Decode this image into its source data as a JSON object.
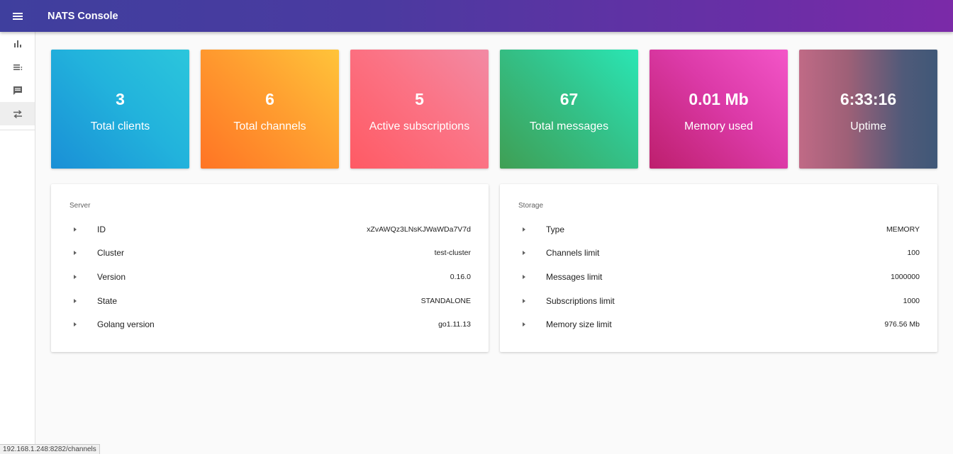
{
  "app": {
    "title": "NATS Console"
  },
  "sidebar": {
    "items": [
      {
        "icon": "bar-chart-icon",
        "active": false
      },
      {
        "icon": "list-icon",
        "active": false
      },
      {
        "icon": "message-icon",
        "active": false
      },
      {
        "icon": "swap-arrows-icon",
        "active": true
      }
    ]
  },
  "stats": [
    {
      "value": "3",
      "label": "Total clients"
    },
    {
      "value": "6",
      "label": "Total channels"
    },
    {
      "value": "5",
      "label": "Active subscriptions"
    },
    {
      "value": "67",
      "label": "Total messages"
    },
    {
      "value": "0.01 Mb",
      "label": "Memory used"
    },
    {
      "value": "6:33:16",
      "label": "Uptime"
    }
  ],
  "server": {
    "title": "Server",
    "rows": [
      {
        "key": "ID",
        "value": "xZvAWQz3LNsKJWaWDa7V7d"
      },
      {
        "key": "Cluster",
        "value": "test-cluster"
      },
      {
        "key": "Version",
        "value": "0.16.0"
      },
      {
        "key": "State",
        "value": "STANDALONE"
      },
      {
        "key": "Golang version",
        "value": "go1.11.13"
      }
    ]
  },
  "storage": {
    "title": "Storage",
    "rows": [
      {
        "key": "Type",
        "value": "MEMORY"
      },
      {
        "key": "Channels limit",
        "value": "100"
      },
      {
        "key": "Messages limit",
        "value": "1000000"
      },
      {
        "key": "Subscriptions limit",
        "value": "1000"
      },
      {
        "key": "Memory size limit",
        "value": "976.56 Mb"
      }
    ]
  },
  "status_url": "192.168.1.248:8282/channels",
  "colors": {
    "topbar_start": "#3f3f9e",
    "topbar_end": "#7b2aa8"
  }
}
